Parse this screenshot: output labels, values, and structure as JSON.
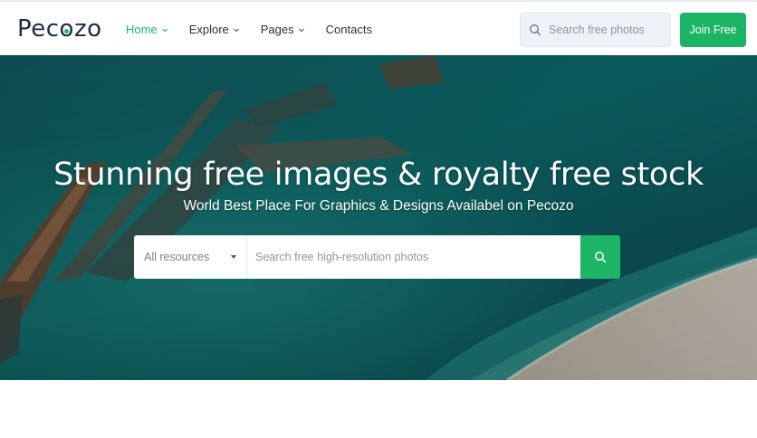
{
  "brand": {
    "logo_text_1": "Pec",
    "logo_text_2": "o",
    "logo_text_3": "zo"
  },
  "nav": {
    "items": [
      {
        "label": "Home",
        "has_dropdown": true,
        "active": true
      },
      {
        "label": "Explore",
        "has_dropdown": true,
        "active": false
      },
      {
        "label": "Pages",
        "has_dropdown": true,
        "active": false
      },
      {
        "label": "Contacts",
        "has_dropdown": false,
        "active": false
      }
    ],
    "search_placeholder": "Search free photos",
    "join_label": "Join Free"
  },
  "hero": {
    "title": "Stunning free images & royalty free stock",
    "subtitle": "World Best Place For Graphics & Designs Availabel on Pecozo",
    "resource_select": "All resources",
    "search_placeholder": "Search free high-resolution photos"
  },
  "colors": {
    "accent": "#1cb565",
    "text": "#2b2d42",
    "nav_search_bg": "#eef1f6"
  },
  "icons": {
    "nav_search": "search-icon",
    "hero_search": "search-icon",
    "dropdown": "chevron-down-icon"
  }
}
